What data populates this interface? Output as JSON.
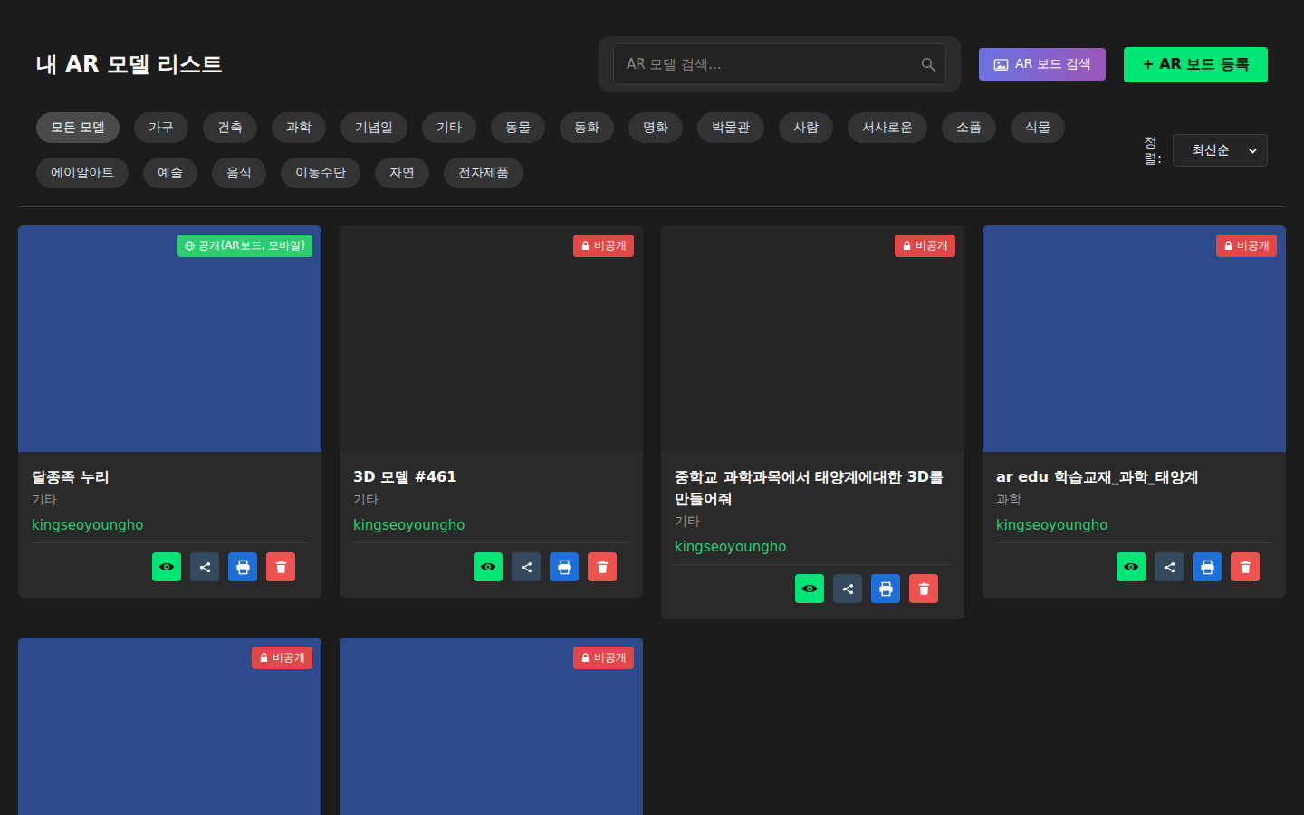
{
  "page": {
    "title": "내 AR 모델 리스트"
  },
  "search": {
    "placeholder": "AR 모델 검색..."
  },
  "header_buttons": [
    {
      "label": "AR 보드 검색",
      "kind": "board-search"
    },
    {
      "label": "+ AR 보드 등록",
      "kind": "create"
    }
  ],
  "categories": [
    {
      "label": "모든 모델",
      "selected": true
    },
    {
      "label": "가구",
      "selected": false
    },
    {
      "label": "건축",
      "selected": false
    },
    {
      "label": "과학",
      "selected": false
    },
    {
      "label": "기념일",
      "selected": false
    },
    {
      "label": "기타",
      "selected": false
    },
    {
      "label": "동물",
      "selected": false
    },
    {
      "label": "동화",
      "selected": false
    },
    {
      "label": "명화",
      "selected": false
    },
    {
      "label": "박물관",
      "selected": false
    },
    {
      "label": "사람",
      "selected": false
    },
    {
      "label": "서사로운",
      "selected": false
    },
    {
      "label": "소품",
      "selected": false
    },
    {
      "label": "식물",
      "selected": false
    },
    {
      "label": "에이알아트",
      "selected": false
    },
    {
      "label": "예술",
      "selected": false
    },
    {
      "label": "음식",
      "selected": false
    },
    {
      "label": "이동수단",
      "selected": false
    },
    {
      "label": "자연",
      "selected": false
    },
    {
      "label": "전자제품",
      "selected": false
    }
  ],
  "sort": {
    "label": "정렬:",
    "value": "최신순"
  },
  "models": [
    {
      "title": "달종족 누리",
      "category": "기타",
      "author": "kingseoyoungho",
      "badge": {
        "label": "공개(AR보드, 모바일)",
        "public": true
      },
      "preview_color": "#2d4a8c"
    },
    {
      "title": "3D 모델 #461",
      "category": "기타",
      "author": "kingseoyoungho",
      "badge": {
        "label": "비공개",
        "public": false
      },
      "preview_color": "#262626"
    },
    {
      "title": "중학교 과학과목에서 태양계에대한 3D를 만들어줘",
      "category": "기타",
      "author": "kingseoyoungho",
      "badge": {
        "label": "비공개",
        "public": false
      },
      "preview_color": "#262626"
    },
    {
      "title": "ar edu 학습교재_과학_태양계",
      "category": "과학",
      "author": "kingseoyoungho",
      "badge": {
        "label": "비공개",
        "public": false
      },
      "preview_color": "#2d4a8c"
    },
    {
      "badge": {
        "label": "비공개",
        "public": false
      },
      "preview_color": "#2d4a8c"
    },
    {
      "badge": {
        "label": "비공개",
        "public": false
      },
      "preview_color": "#2d4a8c"
    }
  ]
}
